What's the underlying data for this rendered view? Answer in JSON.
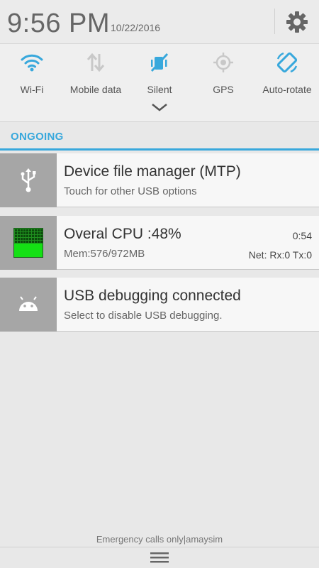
{
  "header": {
    "time": "9:56 PM",
    "date": "10/22/2016",
    "settings_icon": "gear-icon"
  },
  "quick_settings": [
    {
      "label": "Wi-Fi",
      "icon": "wifi-icon",
      "active": true
    },
    {
      "label": "Mobile data",
      "icon": "mobile-data-icon",
      "active": false
    },
    {
      "label": "Silent",
      "icon": "silent-icon",
      "active": true
    },
    {
      "label": "GPS",
      "icon": "gps-icon",
      "active": false
    },
    {
      "label": "Auto-rotate",
      "icon": "auto-rotate-icon",
      "active": true
    }
  ],
  "section": {
    "title": "ONGOING"
  },
  "notifications": [
    {
      "title": "Device file manager (MTP)",
      "subtitle": "Touch for other USB options",
      "icon": "usb-icon"
    },
    {
      "title": "Overal CPU :48%",
      "subtitle": "Mem:576/972MB",
      "right_top": "0:54",
      "right_bottom": "Net: Rx:0 Tx:0",
      "icon": "cpu-meter-icon",
      "cpu_level": 0.48
    },
    {
      "title": "USB debugging connected",
      "subtitle": "Select to disable USB debugging.",
      "icon": "android-icon"
    }
  ],
  "footer": {
    "status": "Emergency calls only|amaysim",
    "handle_icon": "menu-handle-icon"
  },
  "colors": {
    "accent": "#38a8dc",
    "inactive": "#c8c8c8",
    "cpu_fill": "#14e014"
  }
}
